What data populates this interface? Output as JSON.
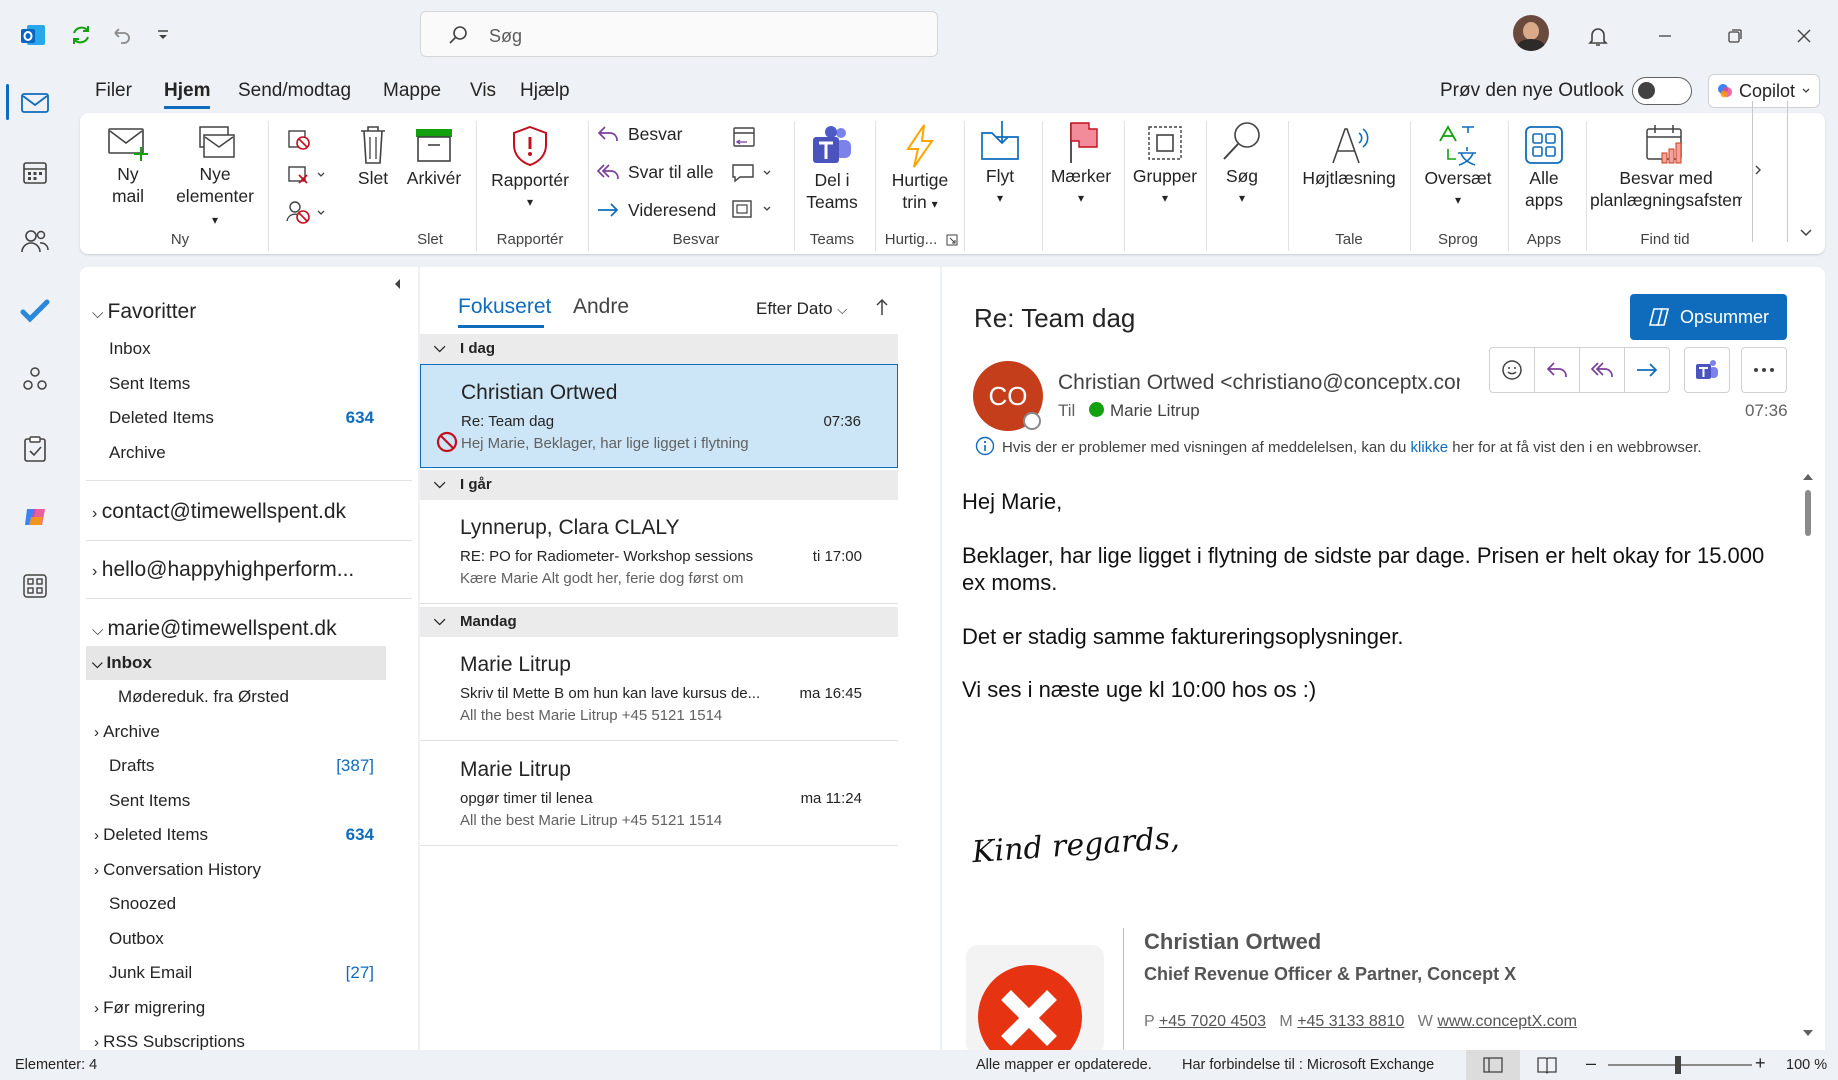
{
  "search": {
    "placeholder": "Søg"
  },
  "menu": {
    "file": "Filer",
    "home": "Hjem",
    "send_receive": "Send/modtag",
    "folder": "Mappe",
    "view": "Vis",
    "help": "Hjælp"
  },
  "header_right": {
    "try_new_outlook": "Prøv den nye Outlook",
    "copilot": "Copilot"
  },
  "ribbon": {
    "new_mail_1": "Ny",
    "new_mail_2": "mail",
    "new_items_1": "Nye",
    "new_items_2": "elementer",
    "group_new": "Ny",
    "delete": "Slet",
    "archive": "Arkivér",
    "group_delete": "Slet",
    "report": "Rapportér",
    "group_report": "Rapportér",
    "reply": "Besvar",
    "reply_all": "Svar til alle",
    "forward": "Videresend",
    "group_reply": "Besvar",
    "share_teams_1": "Del i",
    "share_teams_2": "Teams",
    "group_teams": "Teams",
    "quick_steps_1": "Hurtige",
    "quick_steps_2": "trin",
    "group_quick": "Hurtig...",
    "move": "Flyt",
    "tags": "Mærker",
    "groups": "Grupper",
    "find": "Søg",
    "read_aloud": "Højtlæsning",
    "group_speech": "Tale",
    "translate": "Oversæt",
    "group_language": "Sprog",
    "all_apps_1": "Alle",
    "all_apps_2": "apps",
    "group_apps": "Apps",
    "reply_meeting_1": "Besvar med",
    "reply_meeting_2": "planlægningsafstem",
    "group_findtime": "Find tid"
  },
  "folders": {
    "favorites": "Favoritter",
    "fav_inbox": "Inbox",
    "fav_sent": "Sent Items",
    "fav_deleted": "Deleted Items",
    "fav_deleted_count": "634",
    "fav_archive": "Archive",
    "acc1": "contact@timewellspent.dk",
    "acc2": "hello@happyhighperform...",
    "acc3": "marie@timewellspent.dk",
    "inbox": "Inbox",
    "sub_orsted": "Mødereduk. fra Ørsted",
    "archive": "Archive",
    "drafts": "Drafts",
    "drafts_count": "[387]",
    "sent": "Sent Items",
    "deleted": "Deleted Items",
    "deleted_count": "634",
    "conv_history": "Conversation History",
    "snoozed": "Snoozed",
    "outbox": "Outbox",
    "junk": "Junk Email",
    "junk_count": "[27]",
    "before_migration": "Før migrering",
    "rss": "RSS Subscriptions"
  },
  "list": {
    "tab_focused": "Fokuseret",
    "tab_other": "Andre",
    "sort": "Efter Dato",
    "h_today": "I dag",
    "h_yesterday": "I går",
    "h_monday": "Mandag",
    "items": [
      {
        "sender": "Christian Ortwed",
        "subject": "Re: Team dag",
        "preview": "Hej Marie,   Beklager, har lige ligget i flytning",
        "time": "07:36"
      },
      {
        "sender": "Lynnerup, Clara CLALY",
        "subject": "RE: PO for Radiometer- Workshop sessions",
        "preview": "Kære Marie  Alt godt her, ferie dog først om",
        "time": "ti 17:00"
      },
      {
        "sender": "Marie Litrup",
        "subject": "Skriv til Mette B om hun kan lave kursus de...",
        "preview": "All the best  Marie Litrup  +45 5121 1514",
        "time": "ma 16:45"
      },
      {
        "sender": "Marie Litrup",
        "subject": "opgør timer til lenea",
        "preview": "All the best  Marie Litrup  +45 5121 1514",
        "time": "ma 11:24"
      }
    ]
  },
  "reading": {
    "subject": "Re: Team dag",
    "summarize": "Opsummer",
    "avatar": "CO",
    "from": "Christian Ortwed <christiano@conceptx.cor",
    "to_label": "Til",
    "to_name": "Marie Litrup",
    "time": "07:36",
    "info_1": "Hvis der er problemer med visningen af meddelelsen, kan du ",
    "info_link": "klikke",
    "info_2": " her for at få vist den i en webbrowser.",
    "body_1": "Hej Marie,",
    "body_2a": "Beklager, har lige ligget i flytning de sidste par dage. Prisen er helt okay for 15.000",
    "body_2b": "ex moms.",
    "body_3": "Det er stadig samme faktureringsoplysninger.",
    "body_4": "Vi ses i næste uge kl 10:00 hos os :)",
    "signoff": "Kind regards,",
    "sig_name": "Christian Ortwed",
    "sig_title": "Chief Revenue Officer & Partner, Concept X",
    "sig_p_label": "P",
    "sig_p": "+45 7020 4503",
    "sig_m_label": "M",
    "sig_m": "+45 3133 8810",
    "sig_w_label": "W",
    "sig_w": "www.conceptX.com"
  },
  "status": {
    "items": "Elementer: 4",
    "updated": "Alle mapper er opdaterede.",
    "connected": "Har forbindelse til : Microsoft Exchange",
    "zoom": "100 %"
  },
  "colors": {
    "accent": "#0f6cbd",
    "selected": "#cde6f7",
    "avatar": "#c43e1c"
  }
}
